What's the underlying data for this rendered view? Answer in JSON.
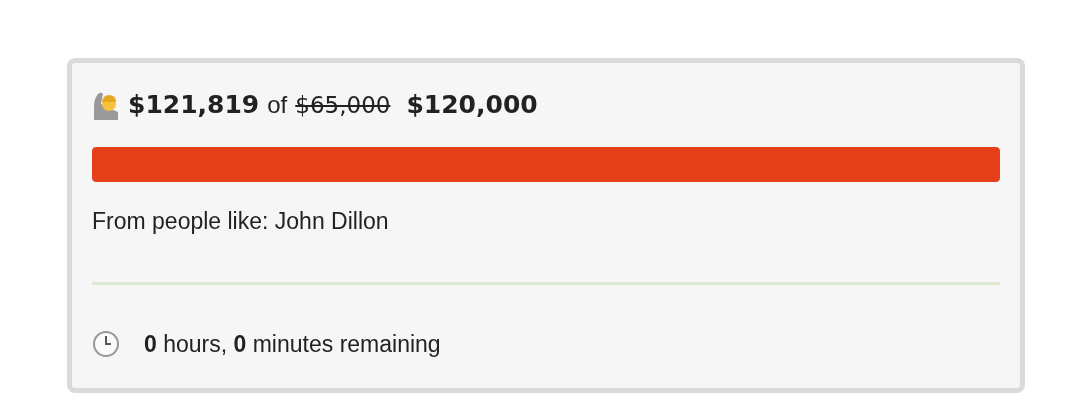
{
  "campaign": {
    "raised": "$121,819",
    "of": "of",
    "old_goal": "$65,000",
    "old_goal_struck": true,
    "goal": "$120,000"
  },
  "progress": {
    "level": 1.0
  },
  "supporters": "From people like: John Dillon",
  "remaining": "**0** hours, **0** minutes remaining"
}
